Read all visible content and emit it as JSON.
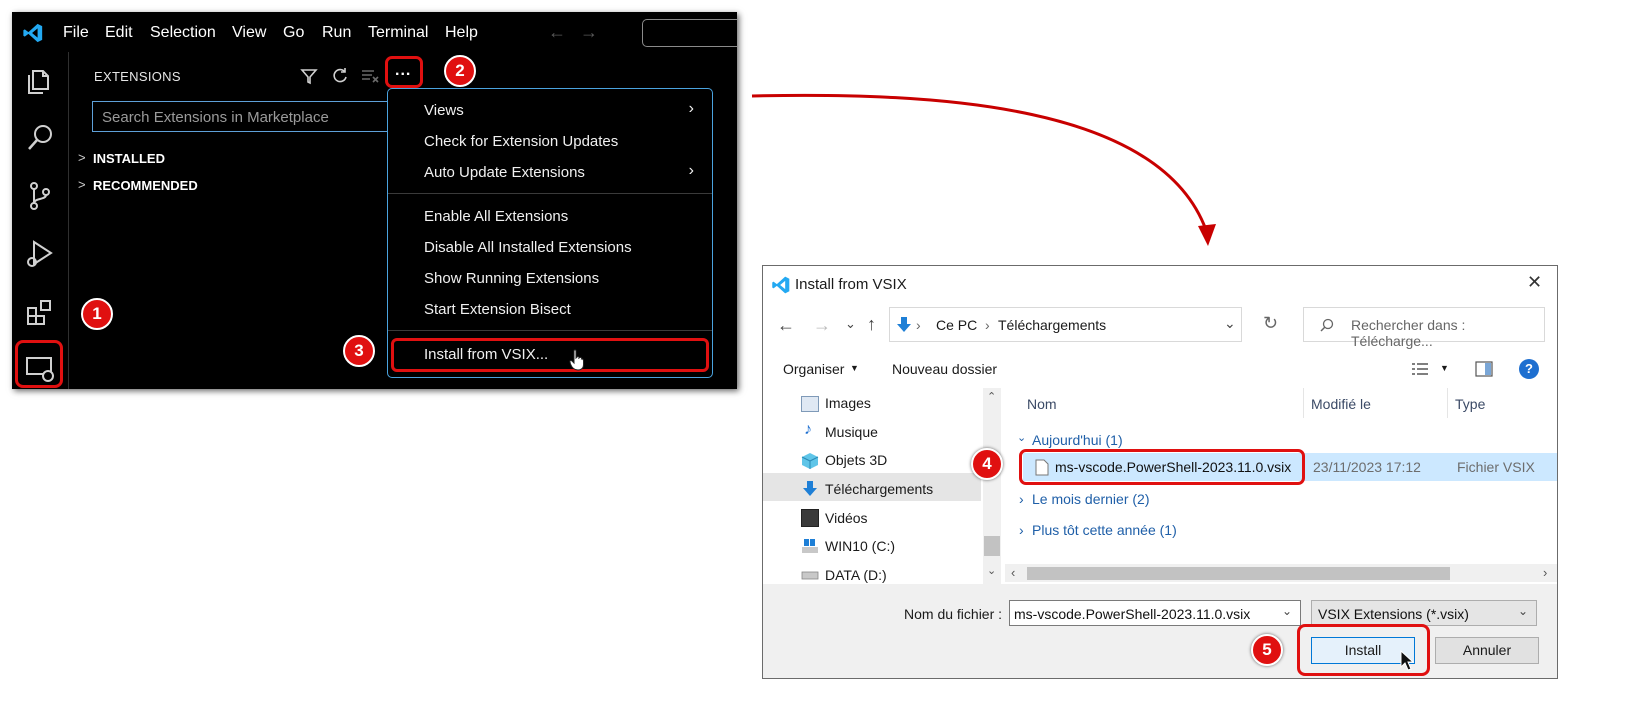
{
  "vscode": {
    "menu": [
      "File",
      "Edit",
      "Selection",
      "View",
      "Go",
      "Run",
      "Terminal",
      "Help"
    ],
    "sidebar_title": "EXTENSIONS",
    "search_placeholder": "Search Extensions in Marketplace",
    "sections": [
      "INSTALLED",
      "RECOMMENDED"
    ],
    "more_actions_label": "...",
    "context_menu": {
      "views": "Views",
      "check_updates": "Check for Extension Updates",
      "auto_update": "Auto Update Extensions",
      "enable_all": "Enable All Extensions",
      "disable_all": "Disable All Installed Extensions",
      "show_running": "Show Running Extensions",
      "bisect": "Start Extension Bisect",
      "install_vsix": "Install from VSIX..."
    }
  },
  "badges": [
    "1",
    "2",
    "3",
    "4",
    "5"
  ],
  "dialog": {
    "title": "Install from VSIX",
    "breadcrumb": [
      "Ce PC",
      "Téléchargements"
    ],
    "search_placeholder": "Rechercher dans : Télécharge...",
    "organize": "Organiser",
    "new_folder": "Nouveau dossier",
    "nav_items": [
      "Images",
      "Musique",
      "Objets 3D",
      "Téléchargements",
      "Vidéos",
      "WIN10 (C:)",
      "DATA (D:)"
    ],
    "columns": [
      "Nom",
      "Modifié le",
      "Type"
    ],
    "groups": {
      "today": "Aujourd'hui (1)",
      "last_month": "Le mois dernier (2)",
      "earlier_year": "Plus tôt cette année (1)"
    },
    "file": {
      "name": "ms-vscode.PowerShell-2023.11.0.vsix",
      "modified": "23/11/2023 17:12",
      "type": "Fichier VSIX"
    },
    "filename_label": "Nom du fichier :",
    "filename_value": "ms-vscode.PowerShell-2023.11.0.vsix",
    "filetype_value": "VSIX Extensions (*.vsix)",
    "install_button": "Install",
    "cancel_button": "Annuler"
  },
  "colors": {
    "highlight": "#e01010",
    "vscode_blue": "#23a9f2",
    "selection_blue": "#cce8ff"
  }
}
